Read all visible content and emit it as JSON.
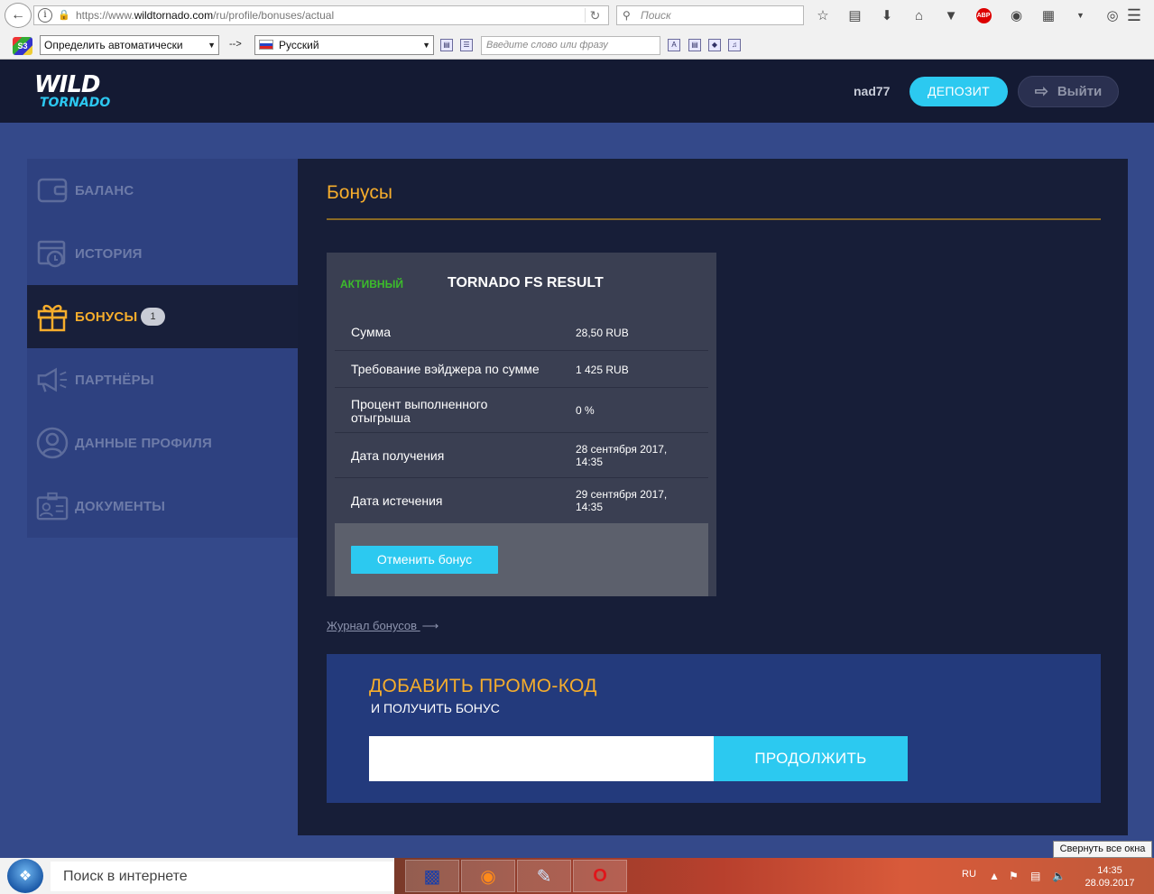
{
  "browser": {
    "url_prefix": "https://www.",
    "url_host": "wildtornado.com",
    "url_path": "/ru/profile/bonuses/actual",
    "search_placeholder": "Поиск",
    "translate": {
      "source_lang": "Определить автоматически",
      "arrow": "-->",
      "target_lang": "Русский",
      "input_placeholder": "Введите слово или фразу"
    },
    "toolbar_icons": [
      "star-icon",
      "reading-list-icon",
      "download-icon",
      "home-icon",
      "pocket-icon",
      "adblock-icon",
      "extension-icon",
      "s3-icon",
      "overflow-icon",
      "sync-icon",
      "menu-icon"
    ]
  },
  "header": {
    "logo_top": "WILD",
    "logo_bottom": "TORNADO",
    "username": "nad77",
    "deposit_label": "ДЕПОЗИТ",
    "logout_label": "Выйти"
  },
  "sidebar": {
    "items": [
      {
        "label": "БАЛАНС",
        "icon": "wallet-icon"
      },
      {
        "label": "ИСТОРИЯ",
        "icon": "calendar-clock-icon"
      },
      {
        "label": "БОНУСЫ",
        "icon": "gift-icon",
        "badge": "1",
        "active": true
      },
      {
        "label": "ПАРТНЁРЫ",
        "icon": "megaphone-icon"
      },
      {
        "label": "ДАННЫЕ ПРОФИЛЯ",
        "icon": "user-icon"
      },
      {
        "label": "ДОКУМЕНТЫ",
        "icon": "id-card-icon"
      }
    ]
  },
  "main": {
    "title": "Бонусы",
    "bonus": {
      "status": "АКТИВНЫЙ",
      "name": "TORNADO FS RESULT",
      "rows": [
        {
          "label": "Сумма",
          "value": "28,50 RUB"
        },
        {
          "label": "Требование вэйджера по сумме",
          "value": "1 425 RUB"
        },
        {
          "label": "Процент выполненного отыгрыша",
          "value": "0 %"
        },
        {
          "label": "Дата получения",
          "value": "28 сентября 2017, 14:35"
        },
        {
          "label": "Дата истечения",
          "value": "29 сентября 2017, 14:35"
        }
      ],
      "cancel_label": "Отменить бонус"
    },
    "journal_link": "Журнал бонусов",
    "promo": {
      "title": "ДОБАВИТЬ ПРОМО-КОД",
      "subtitle": "И ПОЛУЧИТЬ БОНУС",
      "input_value": "",
      "submit_label": "ПРОДОЛЖИТЬ"
    }
  },
  "colors": {
    "accent_cyan": "#2cc9f0",
    "accent_orange": "#f6ad2c",
    "status_green": "#3cbd2b",
    "page_bg": "#34498a",
    "panel_bg": "#171e38"
  },
  "taskbar": {
    "search_placeholder": "Поиск в интернете",
    "lang": "RU",
    "time": "14:35",
    "date": "28.09.2017",
    "tooltip": "Свернуть все окна"
  }
}
